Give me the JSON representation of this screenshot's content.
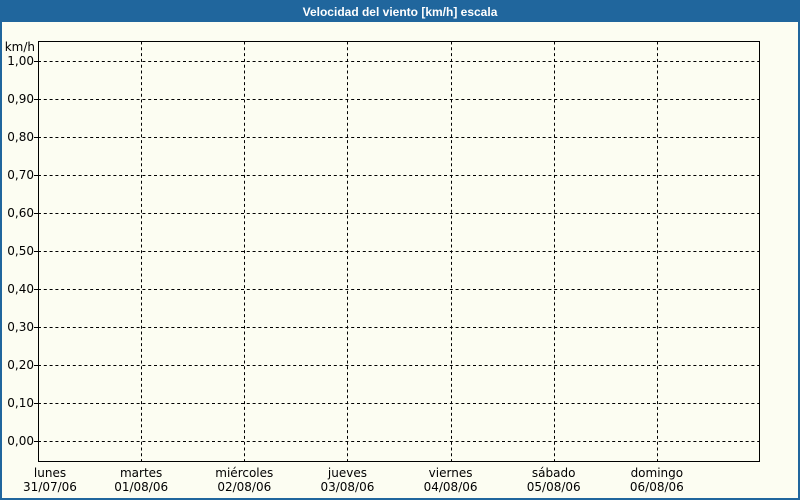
{
  "titlebar": {
    "title": "Velocidad del viento [km/h] escala"
  },
  "colors": {
    "titlebar_bg": "#20669D",
    "titlebar_text": "#FFFFFF",
    "frame_border": "#20669D",
    "background": "#FCFDF2",
    "grid_line": "#000000",
    "axis_line": "#000000",
    "label_text": "#000000"
  },
  "chart_data": {
    "type": "line",
    "title": "Velocidad del viento [km/h] escala",
    "ylabel": "km/h",
    "ylim": [
      0.0,
      1.0
    ],
    "ytick_step": 0.1,
    "yticks": [
      {
        "value": 1.0,
        "label": "1,00"
      },
      {
        "value": 0.9,
        "label": "0,90"
      },
      {
        "value": 0.8,
        "label": "0,80"
      },
      {
        "value": 0.7,
        "label": "0,70"
      },
      {
        "value": 0.6,
        "label": "0,60"
      },
      {
        "value": 0.5,
        "label": "0,50"
      },
      {
        "value": 0.4,
        "label": "0,40"
      },
      {
        "value": 0.3,
        "label": "0,30"
      },
      {
        "value": 0.2,
        "label": "0,20"
      },
      {
        "value": 0.1,
        "label": "0,10"
      },
      {
        "value": 0.0,
        "label": "0,00"
      }
    ],
    "x_categories": [
      {
        "day": "lunes",
        "date": "31/07/06"
      },
      {
        "day": "martes",
        "date": "01/08/06"
      },
      {
        "day": "miércoles",
        "date": "02/08/06"
      },
      {
        "day": "jueves",
        "date": "03/08/06"
      },
      {
        "day": "viernes",
        "date": "04/08/06"
      },
      {
        "day": "sábado",
        "date": "05/08/06"
      },
      {
        "day": "domingo",
        "date": "06/08/06"
      }
    ],
    "series": [],
    "grid": "dashed",
    "legend": "none",
    "note": "empty plot - no data series drawn"
  }
}
